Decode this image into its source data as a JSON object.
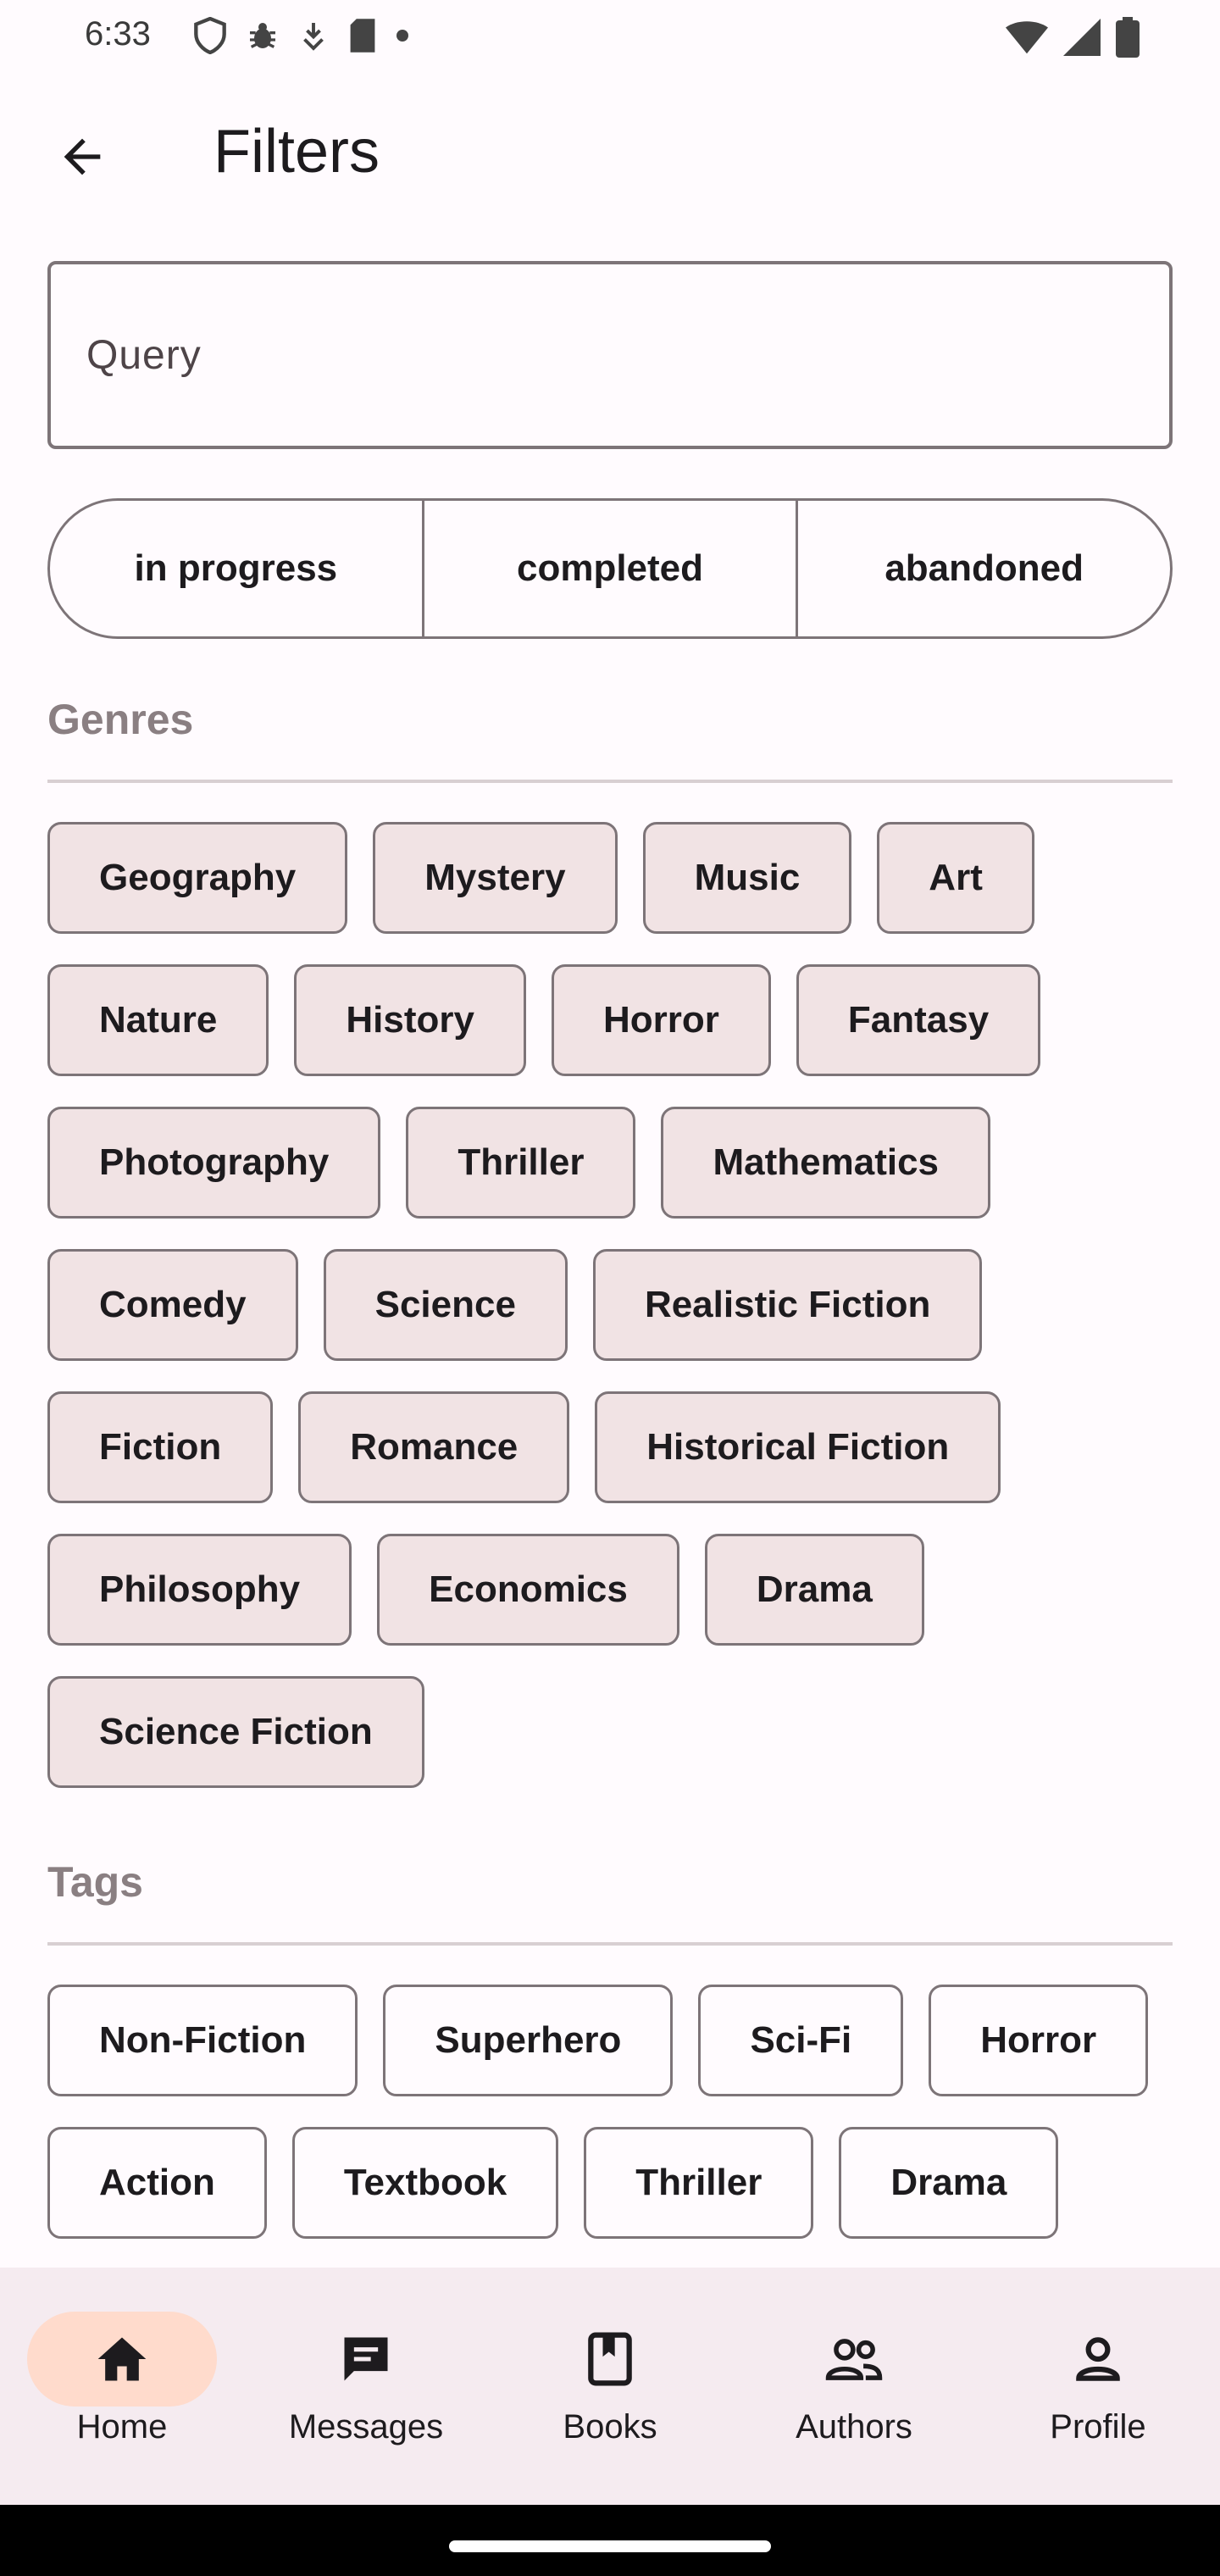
{
  "status_bar": {
    "time": "6:33"
  },
  "app_bar": {
    "title": "Filters"
  },
  "query": {
    "placeholder": "Query",
    "value": ""
  },
  "status_filter": {
    "options": [
      "in progress",
      "completed",
      "abandoned"
    ]
  },
  "genres": {
    "title": "Genres",
    "rows": [
      [
        "Geography",
        "Mystery",
        "Music",
        "Art"
      ],
      [
        "Nature",
        "History",
        "Horror",
        "Fantasy"
      ],
      [
        "Photography",
        "Thriller",
        "Mathematics"
      ],
      [
        "Comedy",
        "Science",
        "Realistic Fiction"
      ],
      [
        "Fiction",
        "Romance",
        "Historical Fiction"
      ],
      [
        "Philosophy",
        "Economics",
        "Drama"
      ],
      [
        "Science Fiction"
      ]
    ]
  },
  "tags": {
    "title": "Tags",
    "rows": [
      [
        "Non-Fiction",
        "Superhero",
        "Sci-Fi",
        "Horror"
      ],
      [
        "Action",
        "Textbook",
        "Thriller",
        "Drama"
      ]
    ]
  },
  "bottom_nav": {
    "items": [
      {
        "label": "Home",
        "icon": "home-icon",
        "selected": true
      },
      {
        "label": "Messages",
        "icon": "messages-icon",
        "selected": false
      },
      {
        "label": "Books",
        "icon": "book-icon",
        "selected": false
      },
      {
        "label": "Authors",
        "icon": "authors-icon",
        "selected": false
      },
      {
        "label": "Profile",
        "icon": "profile-icon",
        "selected": false
      }
    ]
  },
  "colors": {
    "background": "#fffbfe",
    "chip_filled": "#f1e3e4",
    "nav_background": "#f5ebf0",
    "nav_selected_pill": "#ffdbcc",
    "section_title": "#8a7f82"
  }
}
